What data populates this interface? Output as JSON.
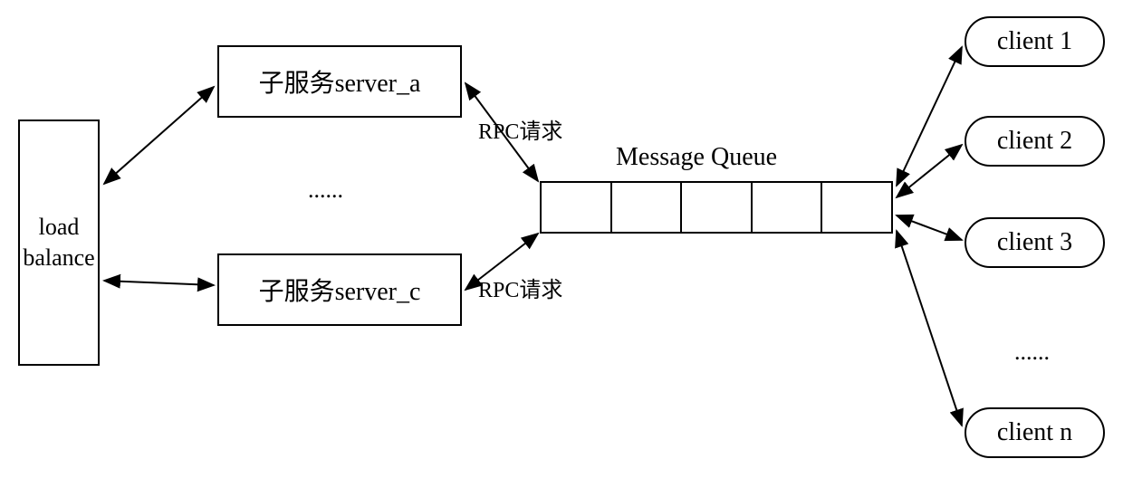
{
  "load_balance": {
    "label": "load\nbalance"
  },
  "servers": {
    "a": {
      "label": "子服务server_a"
    },
    "c": {
      "label": "子服务server_c"
    },
    "ellipsis": "......"
  },
  "rpc": {
    "label1": "RPC请求",
    "label2": "RPC请求"
  },
  "message_queue": {
    "label": "Message Queue",
    "cells": 5
  },
  "clients": {
    "c1": "client 1",
    "c2": "client 2",
    "c3": "client 3",
    "cn": "client n",
    "ellipsis": "......"
  }
}
